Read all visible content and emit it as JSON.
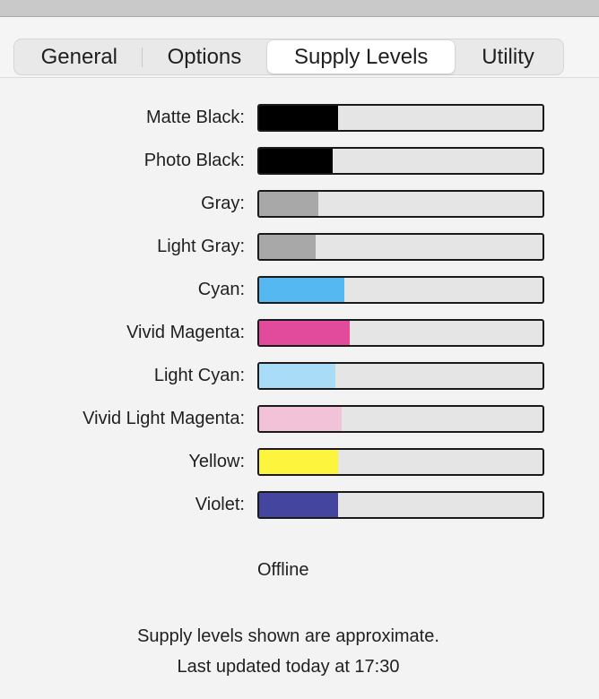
{
  "tabs": [
    {
      "label": "General"
    },
    {
      "label": "Options"
    },
    {
      "label": "Supply Levels",
      "selected": true
    },
    {
      "label": "Utility"
    }
  ],
  "supplies": [
    {
      "label": "Matte Black:",
      "level": 0.28,
      "color": "#000000"
    },
    {
      "label": "Photo Black:",
      "level": 0.26,
      "color": "#000000"
    },
    {
      "label": "Gray:",
      "level": 0.21,
      "color": "#a8a8a8"
    },
    {
      "label": "Light Gray:",
      "level": 0.2,
      "color": "#a8a8a8"
    },
    {
      "label": "Cyan:",
      "level": 0.3,
      "color": "#56b8f0"
    },
    {
      "label": "Vivid Magenta:",
      "level": 0.32,
      "color": "#e24b9c"
    },
    {
      "label": "Light Cyan:",
      "level": 0.27,
      "color": "#a9dcf7"
    },
    {
      "label": "Vivid Light Magenta:",
      "level": 0.29,
      "color": "#f2c2d8"
    },
    {
      "label": "Yellow:",
      "level": 0.28,
      "color": "#fdf43e"
    },
    {
      "label": "Violet:",
      "level": 0.28,
      "color": "#44459f"
    }
  ],
  "status": "Offline",
  "footer": {
    "line1": "Supply levels shown are approximate.",
    "line2": "Last updated today at 17:30"
  }
}
